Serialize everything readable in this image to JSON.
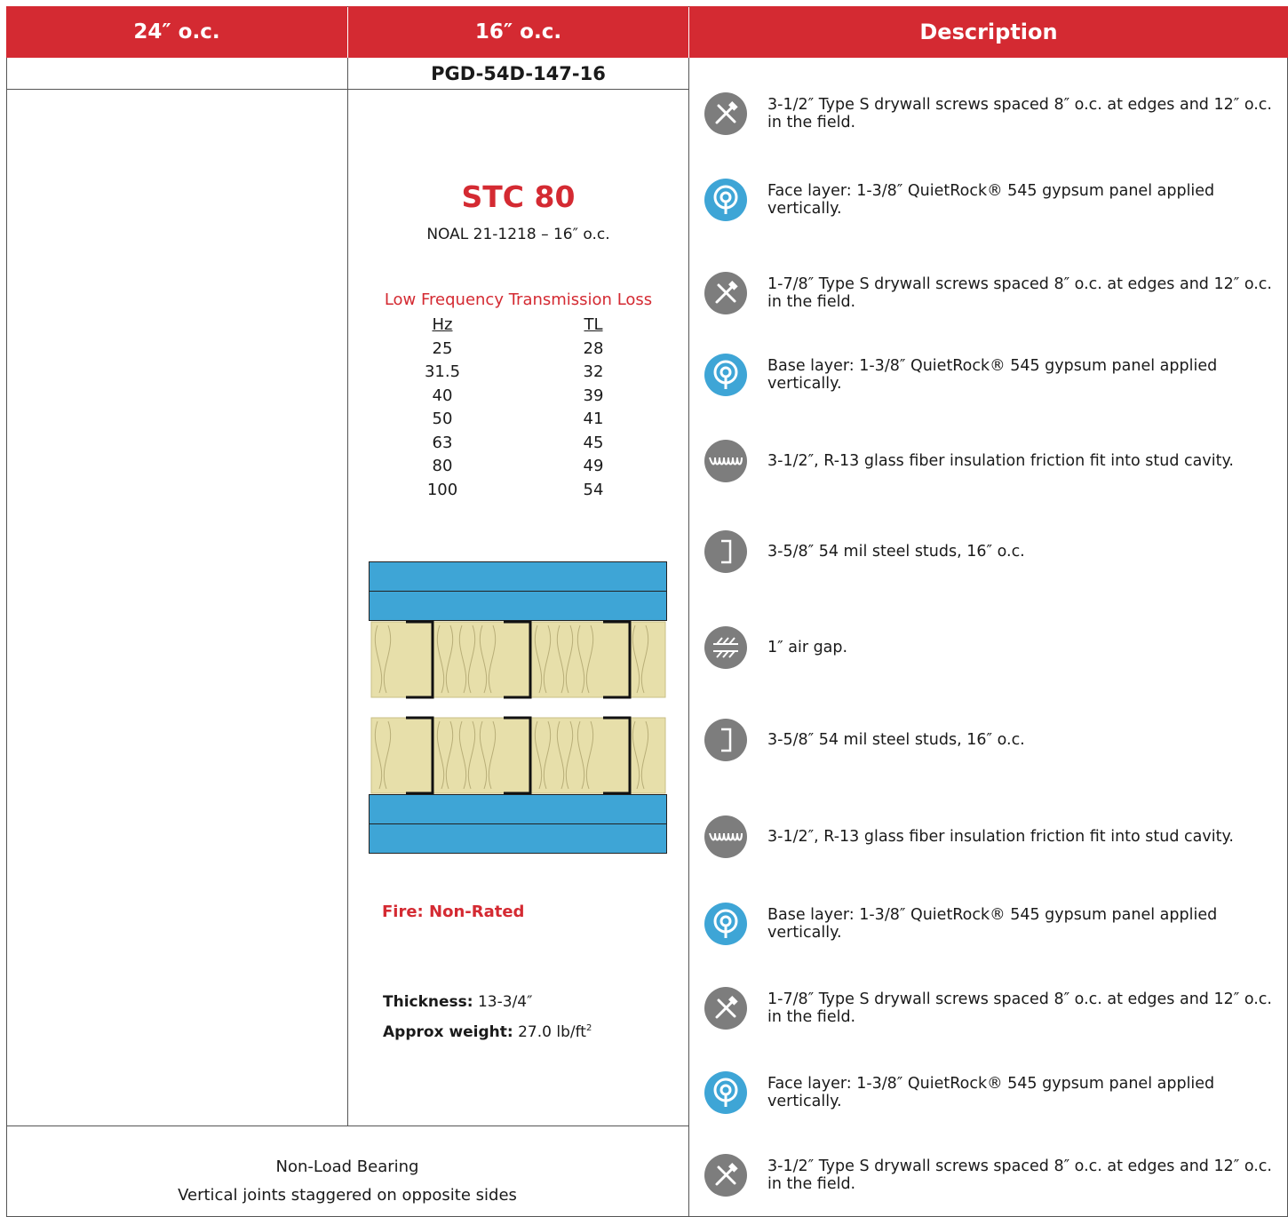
{
  "header": {
    "col1": "24″ o.c.",
    "col2": "16″ o.c.",
    "col3": "Description"
  },
  "assembly_code": "PGD-54D-147-16",
  "stc": "STC 80",
  "noal": "NOAL 21-1218 – 16″ o.c.",
  "lf": {
    "title": "Low Frequency Transmission Loss",
    "hz_header": "Hz",
    "tl_header": "TL",
    "hz": [
      "25",
      "31.5",
      "40",
      "50",
      "63",
      "80",
      "100"
    ],
    "tl": [
      "28",
      "32",
      "39",
      "41",
      "45",
      "49",
      "54"
    ]
  },
  "fire": "Fire: Non-Rated",
  "thickness_label": "Thickness:",
  "thickness_value": "13-3/4″",
  "weight_label": "Approx weight:",
  "weight_value": "27.0 lb/ft",
  "weight_sup": "2",
  "notes": [
    "Non-Load Bearing",
    "Vertical joints staggered on opposite sides"
  ],
  "colors": {
    "header": "#d42a32",
    "accent_red": "#d42a32",
    "panel_blue": "#3ea5d6",
    "insulation": "#e7dfaa",
    "icon_gray": "#808080"
  },
  "descriptions": [
    {
      "icon": "screw-tools-icon",
      "text": "3-1/2″ Type S drywall screws spaced 8″ o.c. at edges and 12″ o.c. in the field."
    },
    {
      "icon": "gypsum-panel-icon",
      "text": "Face layer: 1-3/8″ QuietRock® 545 gypsum panel applied vertically."
    },
    {
      "icon": "screw-tools-icon",
      "text": "1-7/8″ Type S drywall screws spaced 8″ o.c. at edges and 12″ o.c. in the field."
    },
    {
      "icon": "gypsum-panel-icon",
      "text": "Base layer: 1-3/8″ QuietRock® 545 gypsum panel applied vertically."
    },
    {
      "icon": "insulation-icon",
      "text": "3-1/2″, R-13 glass fiber insulation friction fit into stud cavity."
    },
    {
      "icon": "steel-stud-icon",
      "text": "3-5/8″ 54 mil steel studs, 16″ o.c."
    },
    {
      "icon": "air-gap-icon",
      "text": "1″ air gap."
    },
    {
      "icon": "steel-stud-icon",
      "text": "3-5/8″ 54 mil steel studs, 16″ o.c."
    },
    {
      "icon": "insulation-icon",
      "text": "3-1/2″, R-13 glass fiber insulation friction fit into stud cavity."
    },
    {
      "icon": "gypsum-panel-icon",
      "text": "Base layer: 1-3/8″ QuietRock® 545 gypsum panel applied vertically."
    },
    {
      "icon": "screw-tools-icon",
      "text": "1-7/8″ Type S drywall screws spaced 8″ o.c. at edges and 12″ o.c. in the field."
    },
    {
      "icon": "gypsum-panel-icon",
      "text": "Face layer: 1-3/8″ QuietRock® 545 gypsum panel applied vertically."
    },
    {
      "icon": "screw-tools-icon",
      "text": "3-1/2″ Type S drywall screws spaced 8″ o.c. at edges and 12″ o.c. in the field."
    }
  ]
}
